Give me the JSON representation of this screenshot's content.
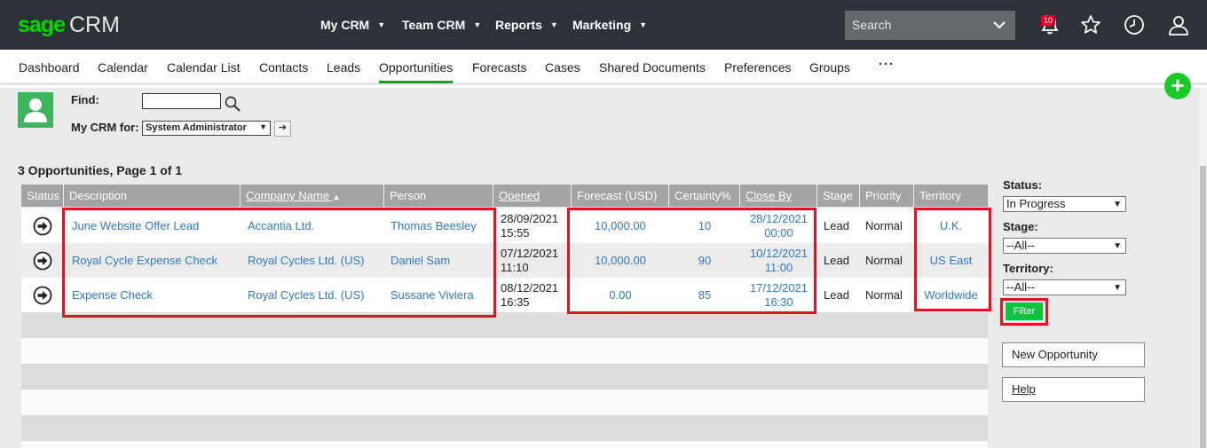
{
  "app": {
    "logo_brand": "sage",
    "logo_product": "CRM"
  },
  "topnav": [
    {
      "label": "My CRM"
    },
    {
      "label": "Team CRM"
    },
    {
      "label": "Reports"
    },
    {
      "label": "Marketing"
    }
  ],
  "search": {
    "placeholder": "Search"
  },
  "notifications": {
    "count": "10"
  },
  "subnav": [
    {
      "label": "Dashboard"
    },
    {
      "label": "Calendar"
    },
    {
      "label": "Calendar List"
    },
    {
      "label": "Contacts"
    },
    {
      "label": "Leads"
    },
    {
      "label": "Opportunities",
      "active": true
    },
    {
      "label": "Forecasts"
    },
    {
      "label": "Cases"
    },
    {
      "label": "Shared Documents"
    },
    {
      "label": "Preferences"
    },
    {
      "label": "Groups"
    }
  ],
  "more_label": "···",
  "find": {
    "label": "Find:",
    "value": ""
  },
  "mycrm_for": {
    "label": "My CRM for:",
    "selected": "System Administrator"
  },
  "results": {
    "title": "3 Opportunities, Page 1 of 1"
  },
  "table": {
    "columns": {
      "status": "Status",
      "description": "Description",
      "company": "Company Name",
      "person": "Person",
      "opened": "Opened",
      "forecast": "Forecast (USD)",
      "certainty": "Certainty%",
      "closeby": "Close By",
      "stage": "Stage",
      "priority": "Priority",
      "territory": "Territory"
    },
    "sort_indicator": "▲",
    "rows": [
      {
        "description": "June Website Offer Lead",
        "company": "Accantia Ltd.",
        "person": "Thomas Beesley",
        "opened_date": "28/09/2021",
        "opened_time": "15:55",
        "forecast": "10,000.00",
        "certainty": "10",
        "close_date": "28/12/2021",
        "close_time": "00:00",
        "stage": "Lead",
        "priority": "Normal",
        "territory": "U.K."
      },
      {
        "description": "Royal Cycle Expense Check",
        "company": "Royal Cycles Ltd. (US)",
        "person": "Daniel Sam",
        "opened_date": "07/12/2021",
        "opened_time": "11:10",
        "forecast": "10,000.00",
        "certainty": "90",
        "close_date": "10/12/2021",
        "close_time": "11:00",
        "stage": "Lead",
        "priority": "Normal",
        "territory": "US East"
      },
      {
        "description": "Expense Check",
        "company": "Royal Cycles Ltd. (US)",
        "person": "Sussane Viviera",
        "opened_date": "08/12/2021",
        "opened_time": "16:35",
        "forecast": "0.00",
        "certainty": "85",
        "close_date": "17/12/2021",
        "close_time": "16:30",
        "stage": "Lead",
        "priority": "Normal",
        "territory": "Worldwide"
      }
    ]
  },
  "filters": {
    "status": {
      "label": "Status:",
      "selected": "In Progress"
    },
    "stage": {
      "label": "Stage:",
      "selected": "--All--"
    },
    "territory": {
      "label": "Territory:",
      "selected": "--All--"
    },
    "filter_button": "Filter"
  },
  "actions": {
    "new_opportunity": "New Opportunity",
    "help": "Help"
  },
  "colors": {
    "topbar": "#2d3239",
    "brand_green": "#00dc00",
    "link_blue": "#2f78c4",
    "highlight_red": "#e0141e",
    "header_gray": "#a3a3a3"
  }
}
